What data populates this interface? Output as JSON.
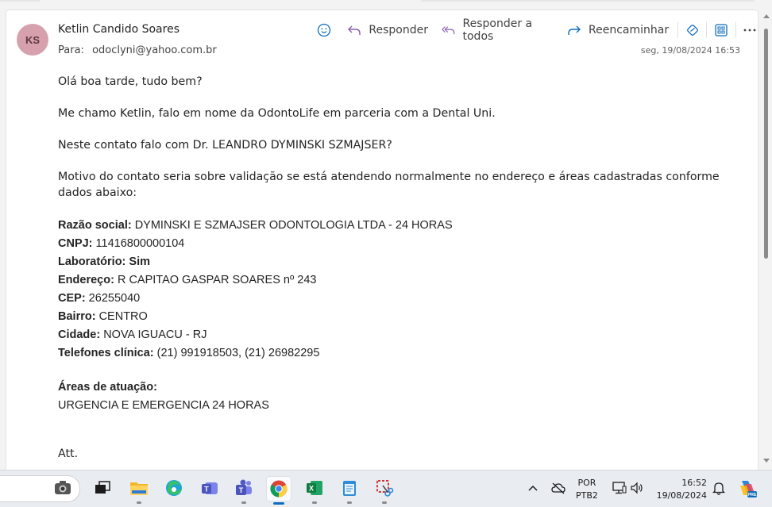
{
  "message": {
    "avatar_initials": "KS",
    "sender_name": "Ketlin Candido Soares",
    "to_label": "Para:",
    "to_address": "odoclyni@yahoo.com.br",
    "date": "seg, 19/08/2024 16:53"
  },
  "toolbar": {
    "reply": "Responder",
    "reply_all": "Responder a todos",
    "forward": "Reencaminhar"
  },
  "body": {
    "greeting": "Olá boa tarde, tudo bem?",
    "intro": "Me chamo Ketlin, falo em nome da OdontoLife em parceria com a Dental Uni.",
    "question": "Neste contato falo com Dr. LEANDRO DYMINSKI SZMAJSER?",
    "reason": "Motivo do contato seria sobre validação se está atendendo normalmente no endereço e áreas cadastradas conforme dados abaixo:",
    "fields": [
      {
        "label": "Razão social:",
        "value": " DYMINSKI E SZMAJSER ODONTOLOGIA LTDA - 24 HORAS"
      },
      {
        "label": "CNPJ:",
        "value": " 11416800000104"
      },
      {
        "label": "Laboratório:",
        "value": " Sim"
      },
      {
        "label": "Endereço:",
        "value": " R CAPITAO GASPAR SOARES nº 243"
      },
      {
        "label": "CEP:",
        "value": " 26255040"
      },
      {
        "label": "Bairro:",
        "value": " CENTRO"
      },
      {
        "label": "Cidade:",
        "value": " NOVA IGUACU - RJ"
      },
      {
        "label": "Telefones clínica:",
        "value": " (21) 991918503, (21) 26982295"
      }
    ],
    "areas_label": "Áreas de atuação:",
    "areas_value": "URGENCIA E EMERGENCIA 24 HORAS",
    "signoff": "Att."
  },
  "taskbar": {
    "apps": [
      "camera-app",
      "task-view",
      "file-explorer",
      "edge-browser",
      "teams-app",
      "teams-work-app",
      "chrome-browser",
      "excel-app",
      "notepad-app",
      "snipping-tool"
    ],
    "lang_line1": "POR",
    "lang_line2": "PTB2",
    "time": "16:52",
    "date": "19/08/2024",
    "copilot_badge": "PRE"
  },
  "colors": {
    "avatar_bg": "#d6a1ad",
    "accent": "#0f6cbd",
    "reply_icon": "#8a5fa8"
  }
}
